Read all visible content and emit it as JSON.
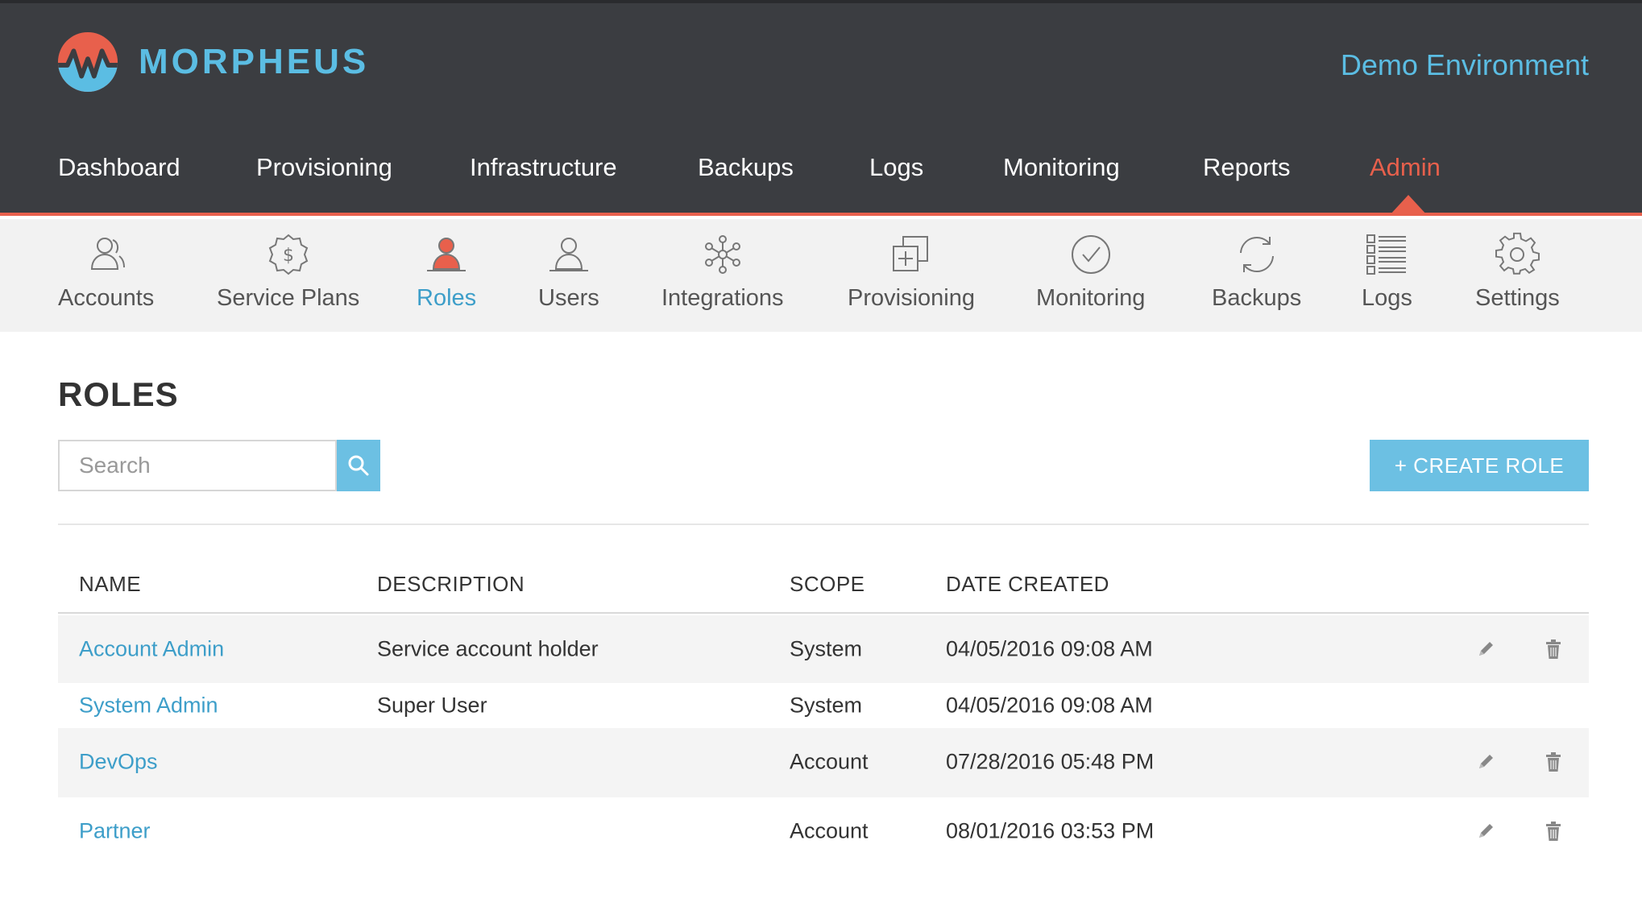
{
  "brand": {
    "name": "MORPHEUS",
    "logo_colors": [
      "#e8604c",
      "#5bbde3"
    ]
  },
  "environment": "Demo Environment",
  "main_nav": [
    {
      "label": "Dashboard"
    },
    {
      "label": "Provisioning"
    },
    {
      "label": "Infrastructure"
    },
    {
      "label": "Backups"
    },
    {
      "label": "Logs"
    },
    {
      "label": "Monitoring"
    },
    {
      "label": "Reports"
    },
    {
      "label": "Admin",
      "active": true
    }
  ],
  "sub_nav": [
    {
      "label": "Accounts",
      "icon": "accounts-icon"
    },
    {
      "label": "Service Plans",
      "icon": "service-plans-icon"
    },
    {
      "label": "Roles",
      "icon": "roles-icon",
      "active": true
    },
    {
      "label": "Users",
      "icon": "users-icon"
    },
    {
      "label": "Integrations",
      "icon": "integrations-icon"
    },
    {
      "label": "Provisioning",
      "icon": "provisioning-icon"
    },
    {
      "label": "Monitoring",
      "icon": "monitoring-icon"
    },
    {
      "label": "Backups",
      "icon": "backups-icon"
    },
    {
      "label": "Logs",
      "icon": "logs-icon"
    },
    {
      "label": "Settings",
      "icon": "settings-icon"
    }
  ],
  "page": {
    "title": "ROLES",
    "search": {
      "placeholder": "Search",
      "value": ""
    },
    "create_button": "+ CREATE ROLE"
  },
  "table": {
    "columns": [
      "NAME",
      "DESCRIPTION",
      "SCOPE",
      "DATE CREATED"
    ],
    "rows": [
      {
        "name": "Account Admin",
        "description": "Service account holder",
        "scope": "System",
        "date": "04/05/2016 09:08 AM",
        "editable": true,
        "deletable": true
      },
      {
        "name": "System Admin",
        "description": "Super User",
        "scope": "System",
        "date": "04/05/2016 09:08 AM",
        "editable": false,
        "deletable": false
      },
      {
        "name": "DevOps",
        "description": "",
        "scope": "Account",
        "date": "07/28/2016 05:48 PM",
        "editable": true,
        "deletable": true
      },
      {
        "name": "Partner",
        "description": "",
        "scope": "Account",
        "date": "08/01/2016 03:53 PM",
        "editable": true,
        "deletable": true
      }
    ]
  },
  "colors": {
    "accent": "#e8604c",
    "link": "#3d9ec9",
    "button": "#6cc0e3",
    "header_bg": "#3b3d41"
  }
}
